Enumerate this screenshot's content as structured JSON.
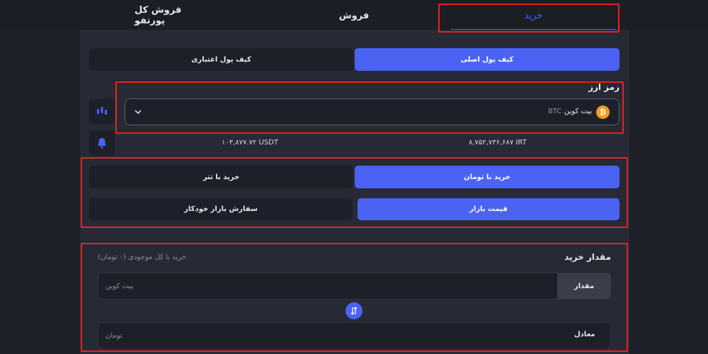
{
  "tabs": {
    "buy": "خرید",
    "sell": "فروش",
    "sell_all_portfolio": "فروش کل پورتفو"
  },
  "wallets": {
    "main": "کیف پول اصلی",
    "credit": "کیف پول اعتباری"
  },
  "currency": {
    "title": "رمز ارز",
    "selected_name": "بیت کوین",
    "selected_symbol": "BTC",
    "coin_icon_glyph": "₿",
    "balance_irt": "۸,۷۵۲,۷۳۶,۶۸۷ IRT",
    "balance_usdt": "۱۰۳,۸۷۷.۷۲ USDT"
  },
  "pay_method": {
    "toman": "خرید با تومان",
    "tether": "خرید با تتر"
  },
  "order_type": {
    "market": "قیمت بازار",
    "auto": "سفارش بازار خودکار"
  },
  "amount": {
    "title": "مقدار خرید",
    "buy_all_hint": "خرید با کل موجودی (۰ تومان)",
    "qty_label": "مقدار",
    "qty_placeholder": "بیت کوین",
    "equiv_label": "معادل",
    "equiv_placeholder": "تومان"
  },
  "colors": {
    "accent": "#4a63f3",
    "highlight": "#e8231c",
    "bitcoin": "#f39b1f"
  }
}
